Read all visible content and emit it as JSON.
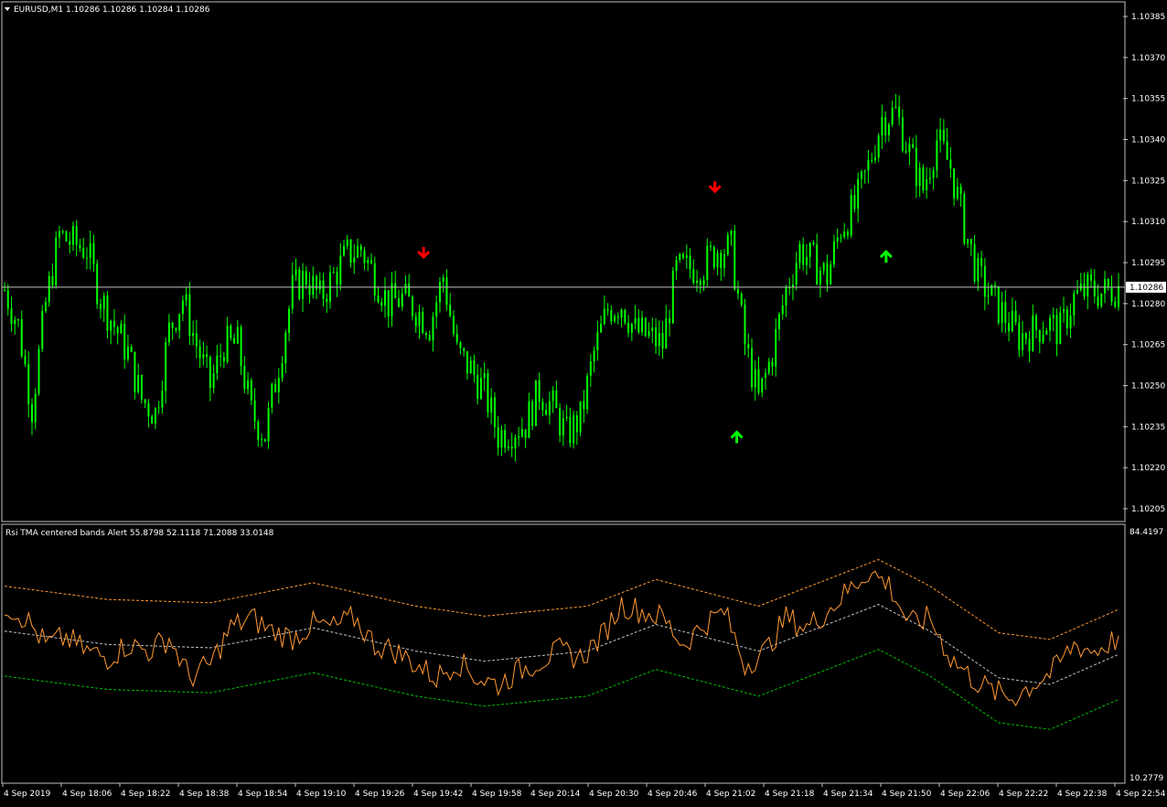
{
  "price_panel": {
    "symbol_header": "EURUSD,M1  1.10286 1.10286 1.10284 1.10286",
    "current_price_label": "1.10286",
    "y_ticks": [
      "1.10385",
      "1.10370",
      "1.10355",
      "1.10340",
      "1.10325",
      "1.10310",
      "1.10295",
      "1.10280",
      "1.10265",
      "1.10250",
      "1.10235",
      "1.10220",
      "1.10205"
    ],
    "candle_color": "#00ff00",
    "price_line_color": "#c0c0c0"
  },
  "indicator_panel": {
    "title": "Rsi TMA centered bands Alert 55.8798 52.1118 71.2088 33.0148",
    "y_top_label": "84.4197",
    "y_bottom_label": "10.2779",
    "rsi_color": "#ff9933",
    "upper_band_color": "#ff9933",
    "middle_color": "#c0c0c0",
    "lower_band_color": "#00c000"
  },
  "time_axis": {
    "labels": [
      "4 Sep 2019",
      "4 Sep 18:06",
      "4 Sep 18:22",
      "4 Sep 18:38",
      "4 Sep 18:54",
      "4 Sep 19:10",
      "4 Sep 19:26",
      "4 Sep 19:42",
      "4 Sep 19:58",
      "4 Sep 20:14",
      "4 Sep 20:30",
      "4 Sep 20:46",
      "4 Sep 21:02",
      "4 Sep 21:18",
      "4 Sep 21:34",
      "4 Sep 21:50",
      "4 Sep 22:06",
      "4 Sep 22:22",
      "4 Sep 22:38",
      "4 Sep 22:54"
    ]
  },
  "signals": [
    {
      "type": "sell-arrow",
      "color": "#ff0000",
      "time": "4 Sep 19:46",
      "price": 1.1029
    },
    {
      "type": "sell-arrow",
      "color": "#ff0000",
      "time": "4 Sep 21:06",
      "price": 1.10314
    },
    {
      "type": "buy-arrow",
      "color": "#00ff00",
      "time": "4 Sep 21:12",
      "price": 1.10239
    },
    {
      "type": "buy-arrow",
      "color": "#00ff00",
      "time": "4 Sep 21:53",
      "price": 1.10305
    }
  ],
  "chart_data": {
    "type": "candlestick",
    "symbol": "EURUSD",
    "timeframe": "M1",
    "last_price": 1.10286,
    "price_anchors": [
      [
        0,
        1.10285
      ],
      [
        4,
        1.10272
      ],
      [
        8,
        1.10242
      ],
      [
        12,
        1.1028
      ],
      [
        16,
        1.10305
      ],
      [
        20,
        1.10302
      ],
      [
        24,
        1.103
      ],
      [
        28,
        1.10282
      ],
      [
        32,
        1.10272
      ],
      [
        36,
        1.10262
      ],
      [
        40,
        1.10245
      ],
      [
        44,
        1.1024
      ],
      [
        48,
        1.1027
      ],
      [
        52,
        1.10282
      ],
      [
        56,
        1.10265
      ],
      [
        60,
        1.1025
      ],
      [
        64,
        1.10265
      ],
      [
        68,
        1.10265
      ],
      [
        72,
        1.1024
      ],
      [
        76,
        1.10232
      ],
      [
        80,
        1.10258
      ],
      [
        84,
        1.10285
      ],
      [
        88,
        1.1029
      ],
      [
        92,
        1.10282
      ],
      [
        96,
        1.1029
      ],
      [
        100,
        1.10298
      ],
      [
        104,
        1.103
      ],
      [
        108,
        1.1029
      ],
      [
        112,
        1.1028
      ],
      [
        116,
        1.10282
      ],
      [
        120,
        1.10278
      ],
      [
        124,
        1.10272
      ],
      [
        128,
        1.1029
      ],
      [
        132,
        1.10262
      ],
      [
        136,
        1.10256
      ],
      [
        140,
        1.10248
      ],
      [
        144,
        1.10232
      ],
      [
        148,
        1.10234
      ],
      [
        152,
        1.10236
      ],
      [
        156,
        1.10248
      ],
      [
        160,
        1.10242
      ],
      [
        164,
        1.10232
      ],
      [
        168,
        1.10238
      ],
      [
        172,
        1.10262
      ],
      [
        176,
        1.10278
      ],
      [
        180,
        1.1028
      ],
      [
        184,
        1.1027
      ],
      [
        188,
        1.10268
      ],
      [
        192,
        1.10265
      ],
      [
        196,
        1.10292
      ],
      [
        200,
        1.10293
      ],
      [
        204,
        1.10294
      ],
      [
        208,
        1.103
      ],
      [
        212,
        1.103
      ],
      [
        216,
        1.10265
      ],
      [
        220,
        1.10245
      ],
      [
        224,
        1.10262
      ],
      [
        228,
        1.10285
      ],
      [
        232,
        1.103
      ],
      [
        236,
        1.10295
      ],
      [
        240,
        1.1029
      ],
      [
        244,
        1.10308
      ],
      [
        248,
        1.10315
      ],
      [
        252,
        1.1033
      ],
      [
        256,
        1.10348
      ],
      [
        260,
        1.1035
      ],
      [
        264,
        1.10335
      ],
      [
        268,
        1.10322
      ],
      [
        272,
        1.1034
      ],
      [
        276,
        1.1033
      ],
      [
        280,
        1.10308
      ],
      [
        284,
        1.1029
      ],
      [
        288,
        1.10282
      ],
      [
        292,
        1.10275
      ],
      [
        296,
        1.10268
      ],
      [
        300,
        1.1027
      ],
      [
        304,
        1.10273
      ],
      [
        308,
        1.1027
      ],
      [
        312,
        1.10282
      ],
      [
        316,
        1.10285
      ],
      [
        320,
        1.10284
      ],
      [
        325,
        1.10286
      ]
    ],
    "rsi_anchors": [
      [
        0,
        62
      ],
      [
        6,
        58
      ],
      [
        12,
        50
      ],
      [
        18,
        52
      ],
      [
        24,
        48
      ],
      [
        30,
        46
      ],
      [
        36,
        50
      ],
      [
        42,
        48
      ],
      [
        48,
        52
      ],
      [
        54,
        40
      ],
      [
        60,
        44
      ],
      [
        66,
        55
      ],
      [
        72,
        58
      ],
      [
        78,
        54
      ],
      [
        84,
        52
      ],
      [
        90,
        56
      ],
      [
        96,
        55
      ],
      [
        102,
        58
      ],
      [
        108,
        50
      ],
      [
        114,
        48
      ],
      [
        120,
        44
      ],
      [
        126,
        40
      ],
      [
        132,
        45
      ],
      [
        138,
        40
      ],
      [
        144,
        38
      ],
      [
        150,
        42
      ],
      [
        156,
        45
      ],
      [
        162,
        48
      ],
      [
        168,
        46
      ],
      [
        174,
        52
      ],
      [
        180,
        62
      ],
      [
        186,
        60
      ],
      [
        192,
        58
      ],
      [
        198,
        50
      ],
      [
        204,
        56
      ],
      [
        210,
        60
      ],
      [
        216,
        44
      ],
      [
        222,
        48
      ],
      [
        228,
        58
      ],
      [
        234,
        55
      ],
      [
        240,
        60
      ],
      [
        246,
        66
      ],
      [
        252,
        72
      ],
      [
        258,
        68
      ],
      [
        264,
        56
      ],
      [
        270,
        58
      ],
      [
        276,
        46
      ],
      [
        282,
        40
      ],
      [
        288,
        36
      ],
      [
        294,
        34
      ],
      [
        300,
        38
      ],
      [
        306,
        42
      ],
      [
        312,
        50
      ],
      [
        318,
        48
      ],
      [
        325,
        52
      ]
    ],
    "band_center_anchors": [
      [
        0,
        54
      ],
      [
        30,
        50
      ],
      [
        60,
        49
      ],
      [
        90,
        55
      ],
      [
        120,
        48
      ],
      [
        140,
        45
      ],
      [
        170,
        48
      ],
      [
        190,
        56
      ],
      [
        220,
        48
      ],
      [
        240,
        56
      ],
      [
        255,
        62
      ],
      [
        270,
        54
      ],
      [
        290,
        40
      ],
      [
        305,
        38
      ],
      [
        325,
        47
      ]
    ],
    "band_half_width": 13.5,
    "rsi_last": 55.8798,
    "tma_middle_last": 52.1118,
    "upper_band_last": 71.2088,
    "lower_band_last": 33.0148,
    "rsi_range": [
      10.2779,
      84.4197
    ],
    "price_range": [
      1.102,
      1.10388
    ]
  }
}
